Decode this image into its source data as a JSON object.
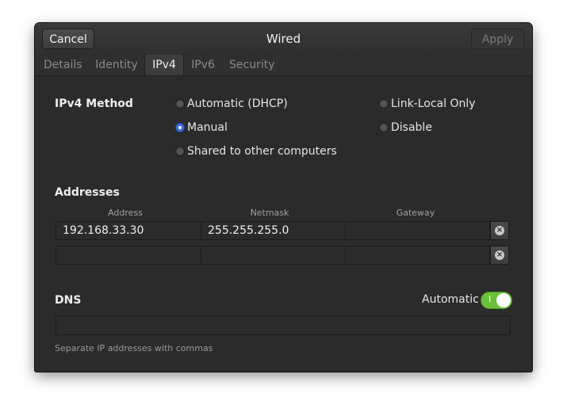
{
  "header": {
    "cancel_label": "Cancel",
    "title": "Wired",
    "apply_label": "Apply"
  },
  "tabs": [
    {
      "label": "Details",
      "active": false
    },
    {
      "label": "Identity",
      "active": false
    },
    {
      "label": "IPv4",
      "active": true
    },
    {
      "label": "IPv6",
      "active": false
    },
    {
      "label": "Security",
      "active": false
    }
  ],
  "ipv4_method": {
    "label": "IPv4 Method",
    "options": [
      {
        "label": "Automatic (DHCP)",
        "selected": false
      },
      {
        "label": "Manual",
        "selected": true
      },
      {
        "label": "Shared to other computers",
        "selected": false
      },
      {
        "label": "Link-Local Only",
        "selected": false
      },
      {
        "label": "Disable",
        "selected": false
      }
    ]
  },
  "addresses": {
    "label": "Addresses",
    "columns": [
      "Address",
      "Netmask",
      "Gateway"
    ],
    "rows": [
      {
        "address": "192.168.33.30",
        "netmask": "255.255.255.0",
        "gateway": ""
      },
      {
        "address": "",
        "netmask": "",
        "gateway": ""
      }
    ]
  },
  "dns": {
    "label": "DNS",
    "automatic_label": "Automatic",
    "automatic_on": true,
    "switch_on_text": "I",
    "value": "",
    "hint": "Separate IP addresses with commas"
  },
  "colors": {
    "selected_radio": "#3a6fd8",
    "switch_on": "#6ac13a",
    "window_bg": "#2b2b2b"
  },
  "icons": {
    "clear_icon": "×"
  }
}
